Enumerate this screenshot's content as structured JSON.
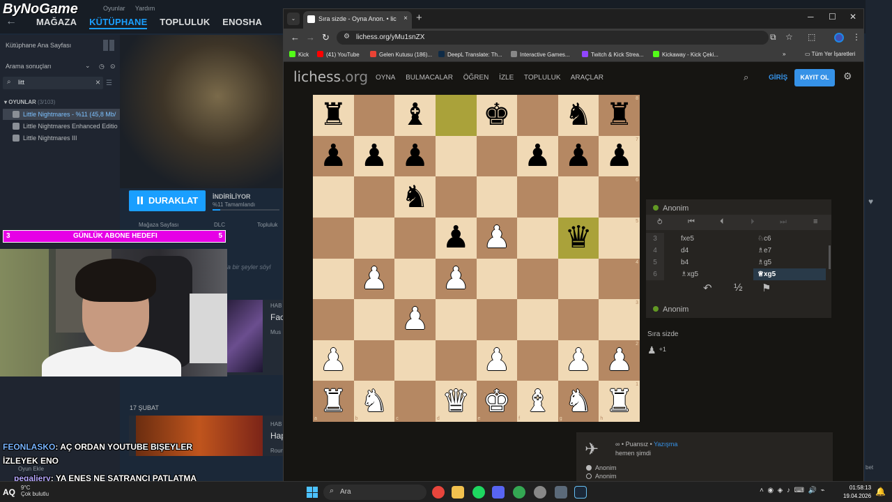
{
  "steam": {
    "logo": "ByNoGame",
    "menu": [
      "Oyunlar",
      "Yardım"
    ],
    "nav": [
      "MAĞAZA",
      "KÜTÜPHANE",
      "TOPLULUK",
      "ENOSHA"
    ],
    "sidebar": {
      "home": "Kütüphane Ana Sayfası",
      "filter": "Arama sonuçları",
      "search_value": "litt",
      "section": "OYUNLAR",
      "section_count": "(3/103)",
      "games": [
        "Little Nightmares - %11 (45,8 Mb/",
        "Little Nightmares Enhanced Editio",
        "Little Nightmares III"
      ]
    },
    "download": {
      "pause_label": "DURAKLAT",
      "status": "İNDİRİLİYOR",
      "sub": "%11 Tamamlandı",
      "progress": 0.11
    },
    "tabs_row": [
      "Mağaza Sayfası",
      "DLC",
      "Topluluk"
    ],
    "empty_hint": "nda bir şeyler söyl",
    "news": [
      {
        "meta": "HAB",
        "title": "Fac",
        "sub": "Mus"
      },
      {
        "meta": "HAB",
        "title": "Hap",
        "sub": "Roun"
      }
    ],
    "date_header": "17 ŞUBAT",
    "add_game": "Oyun Ekle",
    "right_edge": "bet"
  },
  "browser": {
    "tab_title": "Sıra sizde - Oyna Anon. • lic",
    "url": "lichess.org/yMu1snZX",
    "bookmarks": [
      {
        "label": "Kick",
        "color": "#53fc18"
      },
      {
        "label": "(41) YouTube",
        "color": "#ff0000"
      },
      {
        "label": "Gelen Kutusu (186)...",
        "color": "#ea4335"
      },
      {
        "label": "DeepL Translate: Th...",
        "color": "#0f2b46"
      },
      {
        "label": "Interactive Games...",
        "color": "#888888"
      },
      {
        "label": "Twitch & Kick Strea...",
        "color": "#9146ff"
      },
      {
        "label": "Kickaway - Kick Çeki...",
        "color": "#53fc18"
      }
    ],
    "bookmarks_more": "»",
    "all_bookmarks": "Tüm Yer İşaretleri"
  },
  "lichess": {
    "logo": "lichess",
    "logo_tld": ".org",
    "nav": [
      "OYNA",
      "BULMACALAR",
      "ÖĞREN",
      "İZLE",
      "TOPLULUK",
      "ARAÇLAR"
    ],
    "login": "GİRİŞ",
    "signup": "KAYIT OL",
    "board": [
      [
        "br",
        "",
        "bb",
        "",
        "bk",
        "",
        "bn",
        "br"
      ],
      [
        "bp",
        "bp",
        "bp",
        "",
        "",
        "bp",
        "bp",
        "bp"
      ],
      [
        "",
        "",
        "bn",
        "",
        "",
        "",
        "",
        ""
      ],
      [
        "",
        "",
        "",
        "bp",
        "wp",
        "",
        "bq",
        ""
      ],
      [
        "",
        "wp",
        "",
        "wp",
        "",
        "",
        "",
        ""
      ],
      [
        "",
        "",
        "wp",
        "",
        "",
        "",
        "",
        ""
      ],
      [
        "wp",
        "",
        "",
        "",
        "wp",
        "",
        "wp",
        "wp"
      ],
      [
        "wr",
        "wn",
        "",
        "wq",
        "wk",
        "wb",
        "wn",
        "wr"
      ]
    ],
    "highlights": [
      "d8",
      "g5"
    ],
    "files": [
      "a",
      "b",
      "c",
      "d",
      "e",
      "f",
      "g",
      "h"
    ],
    "ranks": [
      "8",
      "7",
      "6",
      "5",
      "4",
      "3",
      "2",
      "1"
    ],
    "opponent": "Anonim",
    "player": "Anonim",
    "moves": [
      {
        "no": "3",
        "white": "fxe5",
        "black": "♘c6"
      },
      {
        "no": "4",
        "white": "d4",
        "black": "♗e7"
      },
      {
        "no": "5",
        "white": "b4",
        "black": "♗g5"
      },
      {
        "no": "6",
        "white": "♗xg5",
        "black": "♕xg5"
      }
    ],
    "turn": "Sıra sizde",
    "material_adv": "+1",
    "chat": {
      "meta_prefix": "∞ • Puansız •",
      "meta_link": "Yazışma",
      "time": "hemen şimdi",
      "users": [
        "Anonim",
        "Anonim"
      ]
    }
  },
  "overlay": {
    "goal_left": "3",
    "goal_text": "GÜNLÜK ABONE HEDEFI",
    "goal_right": "5",
    "chat": [
      {
        "user": "FEONLASKO",
        "msg": ": AÇ ORDAN YOUTUBE BIŞEYLER"
      },
      {
        "user": "",
        "msg": "İZLEYEK ENO"
      },
      {
        "user": "pegaliery",
        "msg": ": YA ENES NE SATRANCI PATLATMA"
      }
    ]
  },
  "taskbar": {
    "aq": "AQ",
    "temp": "9°C",
    "weather": "Çok bulutlu",
    "search": "Ara",
    "time": "01:58:13",
    "date": "19.04.2026"
  }
}
